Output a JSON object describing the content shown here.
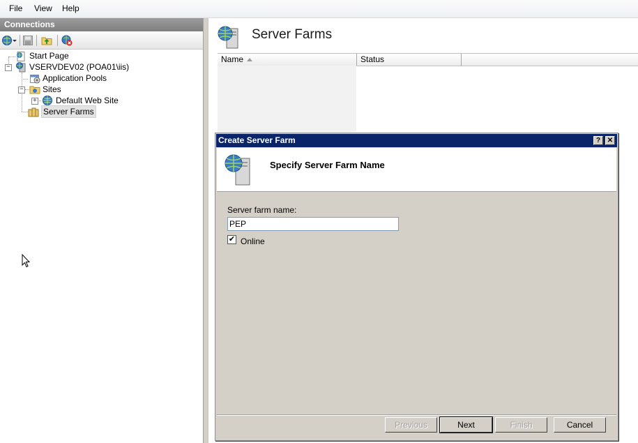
{
  "menu": {
    "file": "File",
    "view": "View",
    "help": "Help"
  },
  "connections": {
    "header": "Connections",
    "tree": {
      "start_page": "Start Page",
      "server": "VSERVDEV02 (POA01\\iis)",
      "app_pools": "Application Pools",
      "sites": "Sites",
      "default_web_site": "Default Web Site",
      "server_farms": "Server Farms"
    },
    "toolbar_icons": [
      "globe-connect-icon",
      "dropdown-arrow-icon",
      "save-icon",
      "up-folder-icon",
      "disconnect-icon"
    ]
  },
  "main": {
    "title": "Server Farms",
    "columns": [
      "Name",
      "Status"
    ]
  },
  "dialog": {
    "title": "Create Server Farm",
    "help_btn": "?",
    "close_btn": "✕",
    "heading": "Specify Server Farm Name",
    "farm_name_label": "Server farm name:",
    "farm_name_value": "PEP",
    "online_label": "Online",
    "online_checked": "✔",
    "buttons": {
      "previous": "Previous",
      "next": "Next",
      "finish": "Finish",
      "cancel": "Cancel"
    }
  },
  "colors": {
    "title_bar": "#0a246a",
    "dialog_face": "#d4d0c8",
    "panel_header": "#8a8a8a"
  }
}
